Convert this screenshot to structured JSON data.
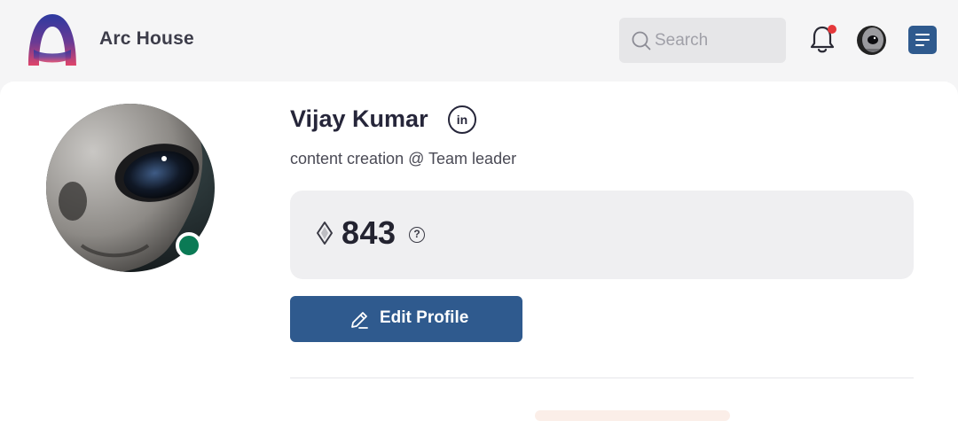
{
  "header": {
    "app_title": "Arc House",
    "search": {
      "placeholder": "Search",
      "value": ""
    },
    "notifications": {
      "has_unread": true
    },
    "icons": [
      "arc-logo",
      "search-icon",
      "bell-icon",
      "avatar",
      "menu-icon"
    ]
  },
  "profile": {
    "name": "Vijay Kumar",
    "social_badge": "in",
    "role": "content creation @ Team leader",
    "status": "online",
    "points": "843",
    "points_icon": "diamond-icon",
    "help_glyph": "?",
    "edit_button_label": "Edit Profile"
  },
  "colors": {
    "accent": "#2f5a8e",
    "online": "#0b7a55",
    "notification_dot": "#e5383b",
    "logo_gradient": [
      "#2d3aa0",
      "#7a3a8a",
      "#e0456a"
    ]
  }
}
